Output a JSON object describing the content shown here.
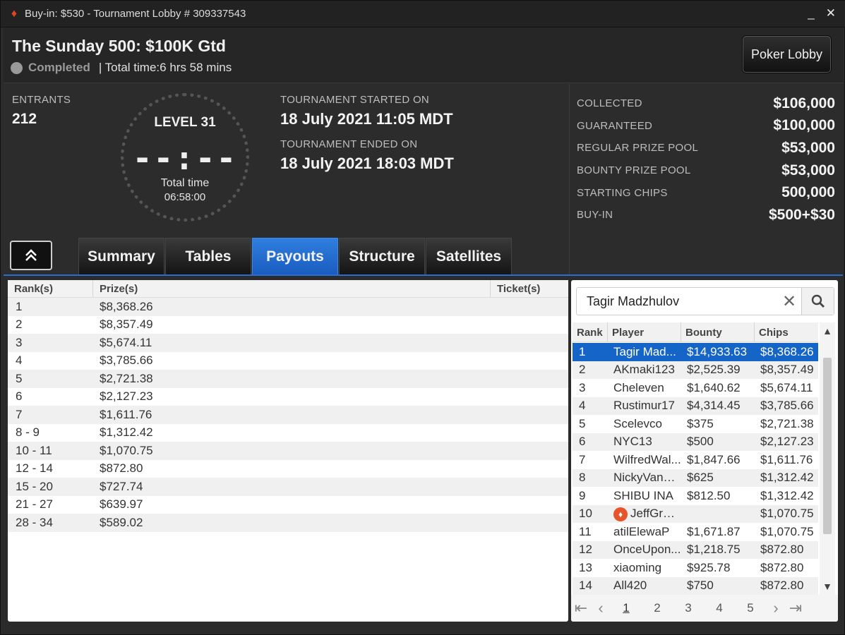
{
  "window": {
    "title": "Buy-in: $530 - Tournament Lobby # 309337543",
    "minimize": "_",
    "close": "✕"
  },
  "header": {
    "tournament_name": "The Sunday 500: $100K Gtd",
    "status": "Completed",
    "total_time": "| Total time:6 hrs  58 mins",
    "poker_lobby_label": "Poker Lobby"
  },
  "info": {
    "entrants_label": "ENTRANTS",
    "entrants_value": "212",
    "clock": {
      "level": "LEVEL 31",
      "digits": "--:--",
      "total_time_label": "Total time",
      "total_time_value": "06:58:00"
    },
    "started_label": "TOURNAMENT STARTED ON",
    "started_value": "18 July 2021  11:05 MDT",
    "ended_label": "TOURNAMENT ENDED ON",
    "ended_value": "18 July 2021  18:03 MDT",
    "prize_rows": [
      {
        "label": "COLLECTED",
        "value": "$106,000"
      },
      {
        "label": "GUARANTEED",
        "value": "$100,000"
      },
      {
        "label": "REGULAR PRIZE POOL",
        "value": "$53,000"
      },
      {
        "label": "BOUNTY PRIZE POOL",
        "value": "$53,000"
      },
      {
        "label": "STARTING CHIPS",
        "value": "500,000"
      },
      {
        "label": "BUY-IN",
        "value": "$500+$30"
      }
    ]
  },
  "tabs": [
    "Summary",
    "Tables",
    "Payouts",
    "Structure",
    "Satellites"
  ],
  "active_tab": "Payouts",
  "payouts": {
    "headers": {
      "rank": "Rank(s)",
      "prize": "Prize(s)",
      "ticket": "Ticket(s)"
    },
    "rows": [
      {
        "rank": "1",
        "prize": "$8,368.26"
      },
      {
        "rank": "2",
        "prize": "$8,357.49"
      },
      {
        "rank": "3",
        "prize": "$5,674.11"
      },
      {
        "rank": "4",
        "prize": "$3,785.66"
      },
      {
        "rank": "5",
        "prize": "$2,721.38"
      },
      {
        "rank": "6",
        "prize": "$2,127.23"
      },
      {
        "rank": "7",
        "prize": "$1,611.76"
      },
      {
        "rank": "8 - 9",
        "prize": "$1,312.42"
      },
      {
        "rank": "10 - 11",
        "prize": "$1,070.75"
      },
      {
        "rank": "12 - 14",
        "prize": "$872.80"
      },
      {
        "rank": "15 - 20",
        "prize": "$727.74"
      },
      {
        "rank": "21 - 27",
        "prize": "$639.97"
      },
      {
        "rank": "28 - 34",
        "prize": "$589.02"
      }
    ]
  },
  "players": {
    "search_value": "Tagir Madzhulov",
    "headers": {
      "rank": "Rank",
      "player": "Player",
      "bounty": "Bounty",
      "chips": "Chips"
    },
    "rows": [
      {
        "rank": "1",
        "player": "Tagir Mad...",
        "bounty": "$14,933.63",
        "chips": "$8,368.26",
        "selected": true
      },
      {
        "rank": "2",
        "player": "AKmaki123",
        "bounty": "$2,525.39",
        "chips": "$8,357.49"
      },
      {
        "rank": "3",
        "player": "Cheleven",
        "bounty": "$1,640.62",
        "chips": "$5,674.11"
      },
      {
        "rank": "4",
        "player": "Rustimur17",
        "bounty": "$4,314.45",
        "chips": "$3,785.66"
      },
      {
        "rank": "5",
        "player": "Scelevco",
        "bounty": "$375",
        "chips": "$2,721.38"
      },
      {
        "rank": "6",
        "player": "NYC13",
        "bounty": "$500",
        "chips": "$2,127.23"
      },
      {
        "rank": "7",
        "player": "WilfredWal...",
        "bounty": "$1,847.66",
        "chips": "$1,611.76"
      },
      {
        "rank": "8",
        "player": "NickyVanE...",
        "bounty": "$625",
        "chips": "$1,312.42"
      },
      {
        "rank": "9",
        "player": "SHIBU INA",
        "bounty": "$812.50",
        "chips": "$1,312.42"
      },
      {
        "rank": "10",
        "player": "JeffGross",
        "bounty": "",
        "chips": "$1,070.75",
        "pro_icon": true
      },
      {
        "rank": "11",
        "player": "atilElewaP",
        "bounty": "$1,671.87",
        "chips": "$1,070.75"
      },
      {
        "rank": "12",
        "player": "OnceUpon...",
        "bounty": "$1,218.75",
        "chips": "$872.80"
      },
      {
        "rank": "13",
        "player": "xiaoming",
        "bounty": "$925.78",
        "chips": "$872.80"
      },
      {
        "rank": "14",
        "player": "All420",
        "bounty": "$750",
        "chips": "$872.80"
      }
    ],
    "pages": [
      "1",
      "2",
      "3",
      "4",
      "5"
    ],
    "current_page": "1"
  }
}
